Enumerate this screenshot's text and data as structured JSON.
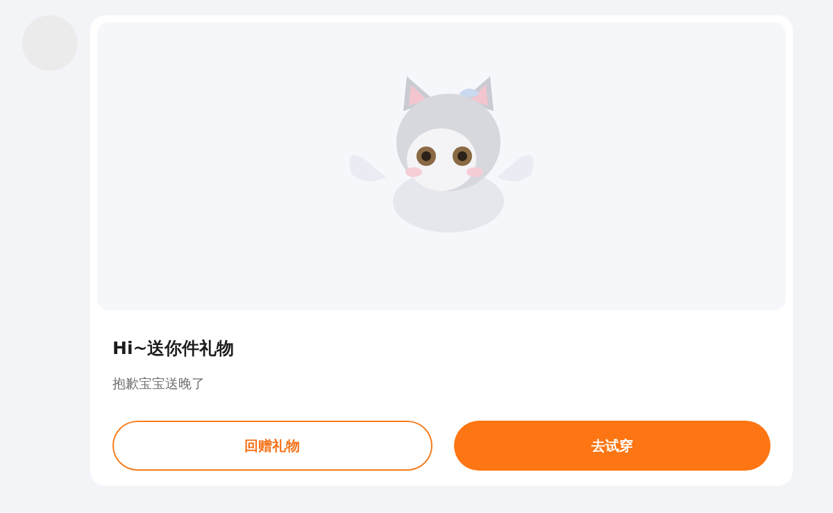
{
  "message": {
    "title": "Hi~送你件礼物",
    "subtitle": "抱歉宝宝送晚了"
  },
  "buttons": [
    {
      "label": "回赠礼物",
      "kind": "outline"
    },
    {
      "label": "去试穿",
      "kind": "filled"
    }
  ]
}
